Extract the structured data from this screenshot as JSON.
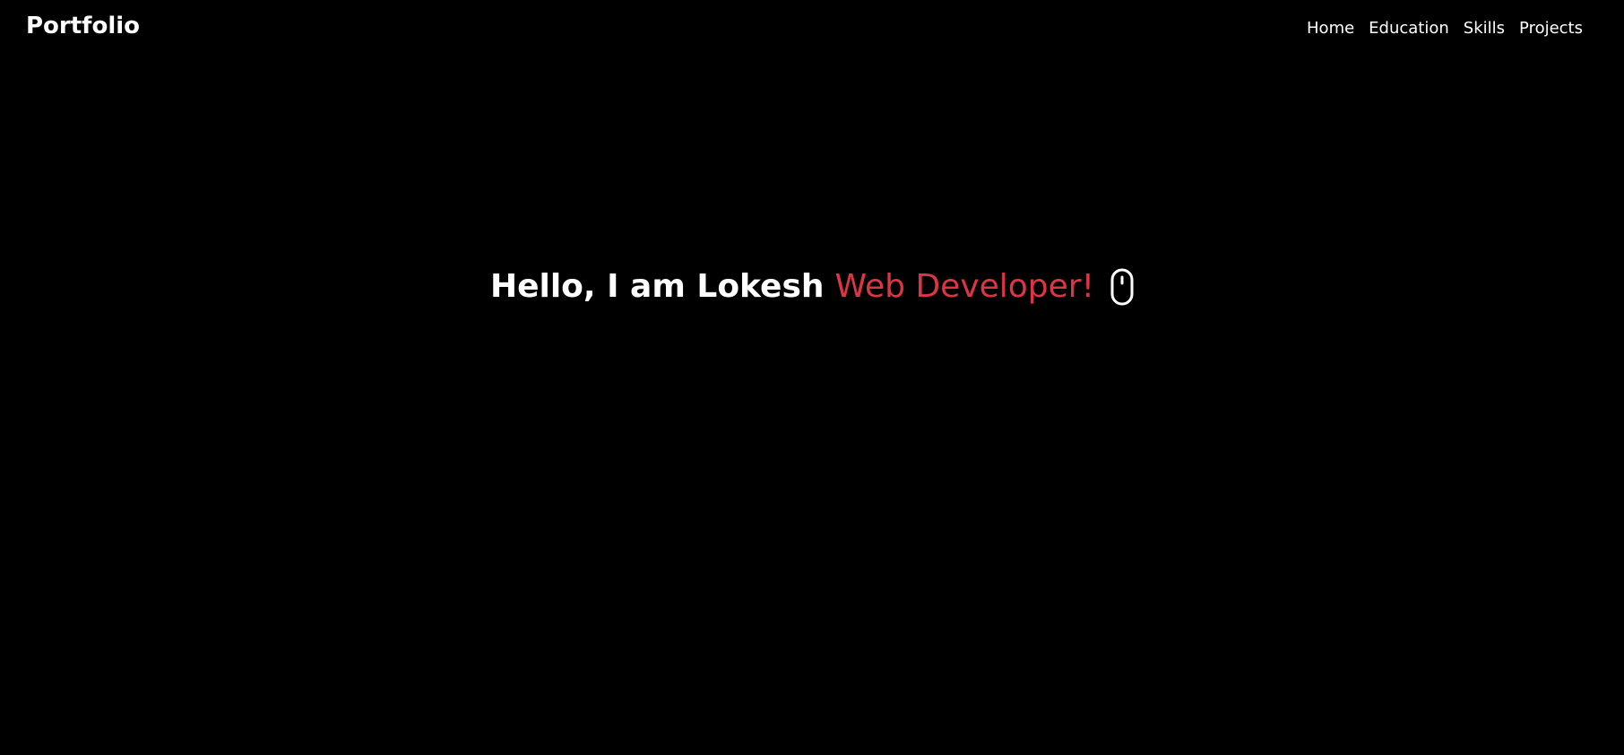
{
  "navbar": {
    "brand": "Portfolio",
    "links": [
      "Home",
      "Education",
      "Skills",
      "Projects"
    ]
  },
  "hero": {
    "greeting": "Hello, I am Lokesh",
    "role": "Web Developer!",
    "icon": "mouse-icon"
  },
  "colors": {
    "background": "#000000",
    "text": "#ffffff",
    "accent": "#dc3545"
  }
}
